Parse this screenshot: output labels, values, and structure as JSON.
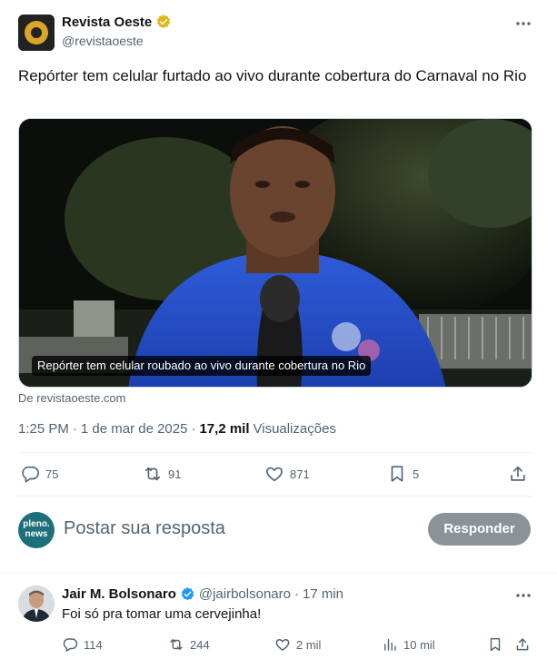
{
  "post": {
    "author_name": "Revista Oeste",
    "author_handle": "@revistaoeste",
    "text": "Repórter tem celular furtado ao vivo durante cobertura do Carnaval no Rio",
    "media_caption": "Repórter tem celular roubado ao vivo durante cobertura no Rio",
    "source": "De revistaoeste.com",
    "time": "1:25 PM",
    "sep": "·",
    "date": "1 de mar de 2025",
    "views_count": "17,2 mil",
    "views_label": "Visualizações",
    "actions": {
      "replies": "75",
      "reposts": "91",
      "likes": "871",
      "bookmarks": "5"
    }
  },
  "reply_box": {
    "avatar_text_1": "pleno.",
    "avatar_text_2": "news",
    "placeholder": "Postar sua resposta",
    "button_label": "Responder"
  },
  "reply": {
    "author_name": "Jair M. Bolsonaro",
    "author_handle": "@jairbolsonaro",
    "sep": "·",
    "time_ago": "17 min",
    "text": "Foi só pra tomar uma cervejinha!",
    "actions": {
      "replies": "114",
      "reposts": "244",
      "likes": "2 mil",
      "views": "10 mil"
    }
  },
  "colors": {
    "verified_gold": "#e2b719",
    "verified_blue": "#1d9bf0",
    "muted_text": "#536471",
    "reply_button_bg": "#8b9298"
  },
  "icons": [
    "more-icon",
    "reply-icon",
    "repost-icon",
    "like-icon",
    "bookmark-icon",
    "share-icon",
    "views-icon",
    "verified-badge-icon"
  ]
}
